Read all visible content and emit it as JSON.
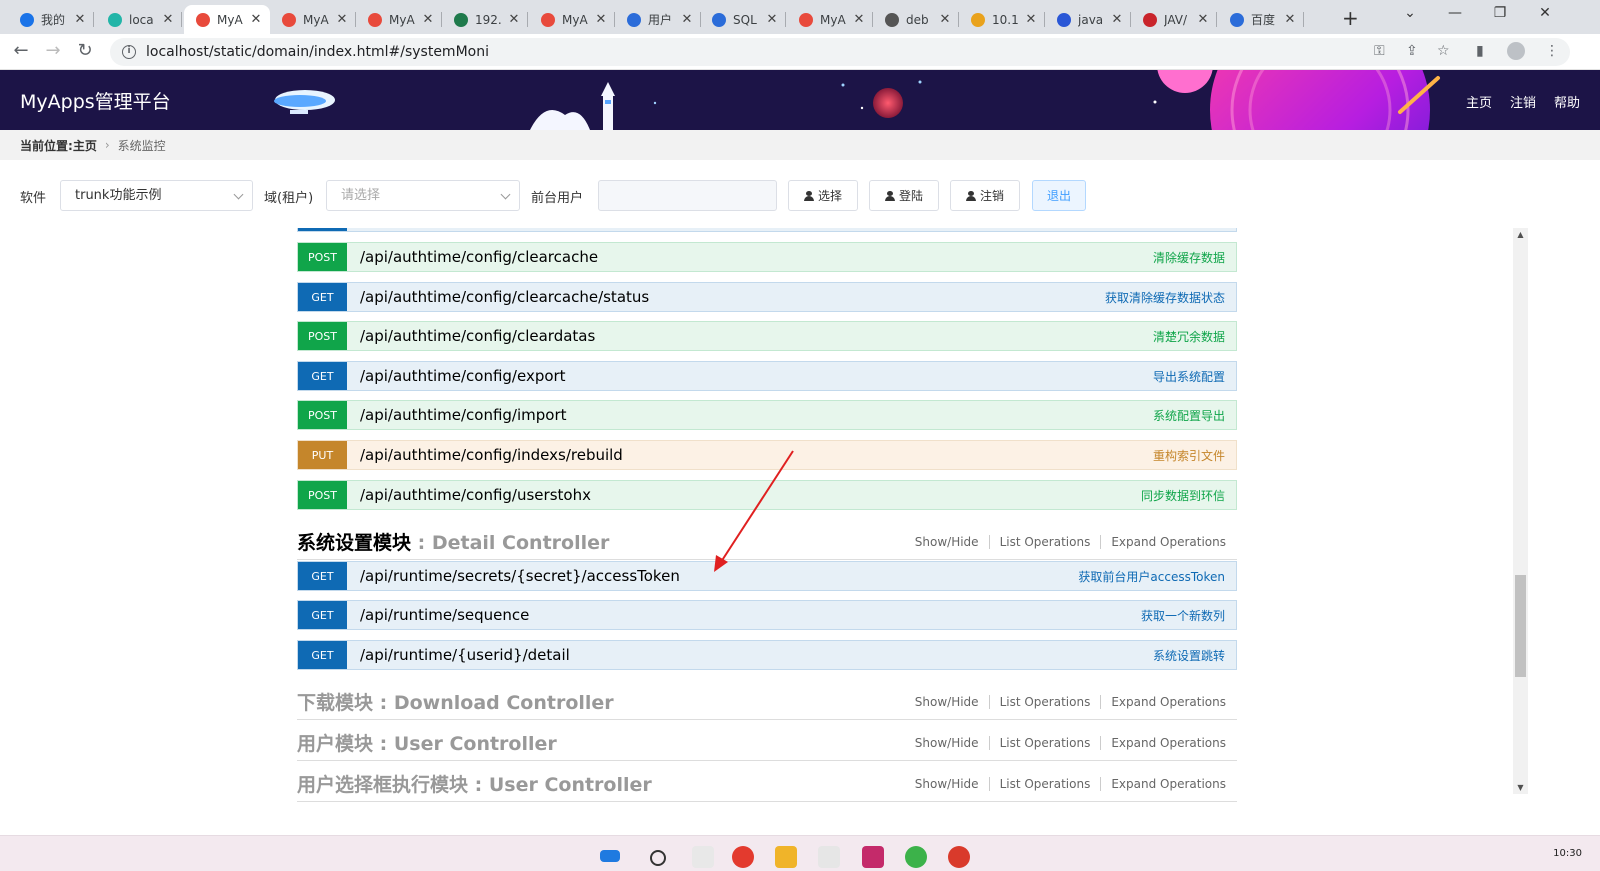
{
  "browser": {
    "tabs": [
      {
        "label": "我的",
        "fav": "#1a73e8",
        "active": false
      },
      {
        "label": "loca",
        "fav": "#22b5a8",
        "active": false
      },
      {
        "label": "MyA",
        "fav": "#e84a3c",
        "active": true
      },
      {
        "label": "MyA",
        "fav": "#e84a3c",
        "active": false
      },
      {
        "label": "MyA",
        "fav": "#e84a3c",
        "active": false
      },
      {
        "label": "192.",
        "fav": "#1f7a4c",
        "active": false
      },
      {
        "label": "MyA",
        "fav": "#e84a3c",
        "active": false
      },
      {
        "label": "用户",
        "fav": "#2b6cd9",
        "active": false
      },
      {
        "label": "SQL",
        "fav": "#2b6cd9",
        "active": false
      },
      {
        "label": "MyA",
        "fav": "#e84a3c",
        "active": false
      },
      {
        "label": "deb",
        "fav": "#555555",
        "active": false
      },
      {
        "label": "10.1",
        "fav": "#e9a21c",
        "active": false
      },
      {
        "label": "java",
        "fav": "#2a57d6",
        "active": false
      },
      {
        "label": "JAV/",
        "fav": "#c9242b",
        "active": false
      },
      {
        "label": "百度",
        "fav": "#2b6cd9",
        "active": false
      }
    ],
    "new_tab": "+",
    "url": "localhost/static/domain/index.html#/systemMoni"
  },
  "app": {
    "title": "MyApps管理平台",
    "nav": [
      "主页",
      "注销",
      "帮助"
    ]
  },
  "breadcrumb": {
    "prefix": "当前位置:",
    "home": "主页",
    "current": "系统监控"
  },
  "filters": {
    "software_label": "软件",
    "software_value": "trunk功能示例",
    "domain_label": "域(租户)",
    "domain_placeholder": "请选择",
    "user_label": "前台用户",
    "btn_select": "选择",
    "btn_login": "登陆",
    "btn_logout": "注销",
    "btn_exit": "退出"
  },
  "operations_top": [
    {
      "method": "POST",
      "path": "/api/authtime/config/clearcache",
      "summary": "清除缓存数据"
    },
    {
      "method": "GET",
      "path": "/api/authtime/config/clearcache/status",
      "summary": "获取清除缓存数据状态"
    },
    {
      "method": "POST",
      "path": "/api/authtime/config/cleardatas",
      "summary": "清楚冗余数据"
    },
    {
      "method": "GET",
      "path": "/api/authtime/config/export",
      "summary": "导出系统配置"
    },
    {
      "method": "POST",
      "path": "/api/authtime/config/import",
      "summary": "系统配置导出"
    },
    {
      "method": "PUT",
      "path": "/api/authtime/config/indexs/rebuild",
      "summary": "重构索引文件"
    },
    {
      "method": "POST",
      "path": "/api/authtime/config/userstohx",
      "summary": "同步数据到环信"
    }
  ],
  "resource_links": {
    "show_hide": "Show/Hide",
    "list_ops": "List Operations",
    "expand_ops": "Expand Operations"
  },
  "resources": [
    {
      "cn": "系统设置模块",
      "sep": " : ",
      "en": "Detail Controller",
      "open": true
    },
    {
      "cn": "下载模块",
      "sep": " : ",
      "en": "Download Controller",
      "open": false
    },
    {
      "cn": "用户模块",
      "sep": " : ",
      "en": "User Controller",
      "open": false
    },
    {
      "cn": "用户选择框执行模块",
      "sep": " : ",
      "en": "User Controller",
      "open": false
    }
  ],
  "operations_detail": [
    {
      "method": "GET",
      "path": "/api/runtime/secrets/{secret}/accessToken",
      "summary": "获取前台用户accessToken"
    },
    {
      "method": "GET",
      "path": "/api/runtime/sequence",
      "summary": "获取一个新数列"
    },
    {
      "method": "GET",
      "path": "/api/runtime/{userid}/detail",
      "summary": "系统设置跳转"
    }
  ],
  "taskbar": {
    "clock": "10:30"
  },
  "colors": {
    "post": "#10a54a",
    "get": "#0f6ab4",
    "put": "#c5862b",
    "header_bg": "#1c1447",
    "annotation_arrow": "#e02020"
  }
}
